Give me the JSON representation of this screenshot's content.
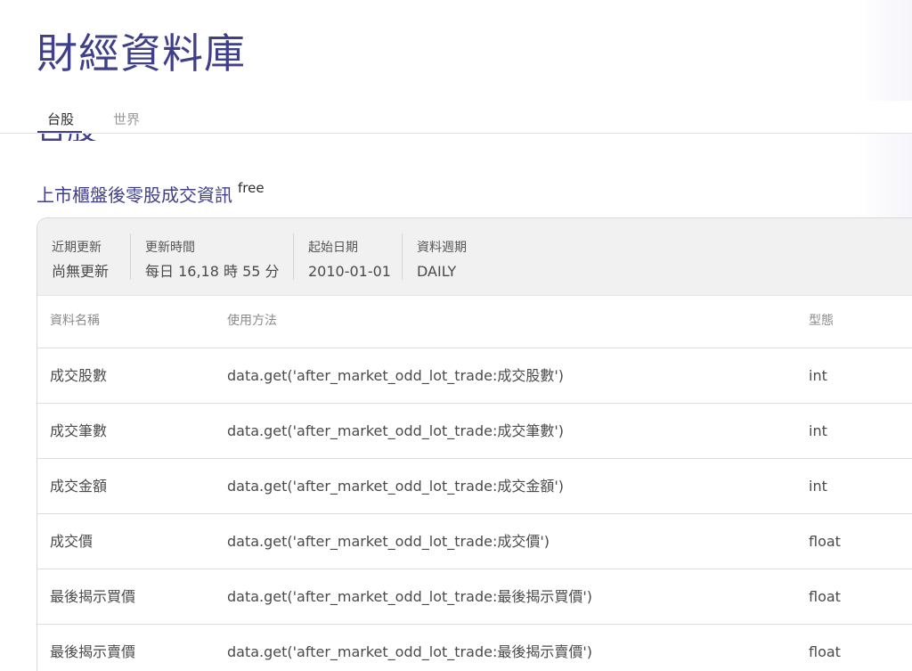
{
  "header": {
    "title": "財經資料庫"
  },
  "tabs": [
    {
      "label": "台股",
      "active": true
    },
    {
      "label": "世界",
      "active": false
    }
  ],
  "section": {
    "heading": "台股"
  },
  "dataset": {
    "title": "上市櫃盤後零股成交資訊",
    "badge": "free",
    "meta": [
      {
        "label": "近期更新",
        "value": "尚無更新"
      },
      {
        "label": "更新時間",
        "value": "每日 16,18 時 55 分"
      },
      {
        "label": "起始日期",
        "value": "2010-01-01"
      },
      {
        "label": "資料週期",
        "value": "DAILY"
      }
    ],
    "table": {
      "columns": [
        "資料名稱",
        "使用方法",
        "型態"
      ],
      "rows": [
        {
          "name": "成交股數",
          "usage": "data.get('after_market_odd_lot_trade:成交股數')",
          "type": "int"
        },
        {
          "name": "成交筆數",
          "usage": "data.get('after_market_odd_lot_trade:成交筆數')",
          "type": "int"
        },
        {
          "name": "成交金額",
          "usage": "data.get('after_market_odd_lot_trade:成交金額')",
          "type": "int"
        },
        {
          "name": "成交價",
          "usage": "data.get('after_market_odd_lot_trade:成交價')",
          "type": "float"
        },
        {
          "name": "最後揭示買價",
          "usage": "data.get('after_market_odd_lot_trade:最後揭示買價')",
          "type": "float"
        },
        {
          "name": "最後揭示賣價",
          "usage": "data.get('after_market_odd_lot_trade:最後揭示賣價')",
          "type": "float"
        }
      ]
    }
  }
}
